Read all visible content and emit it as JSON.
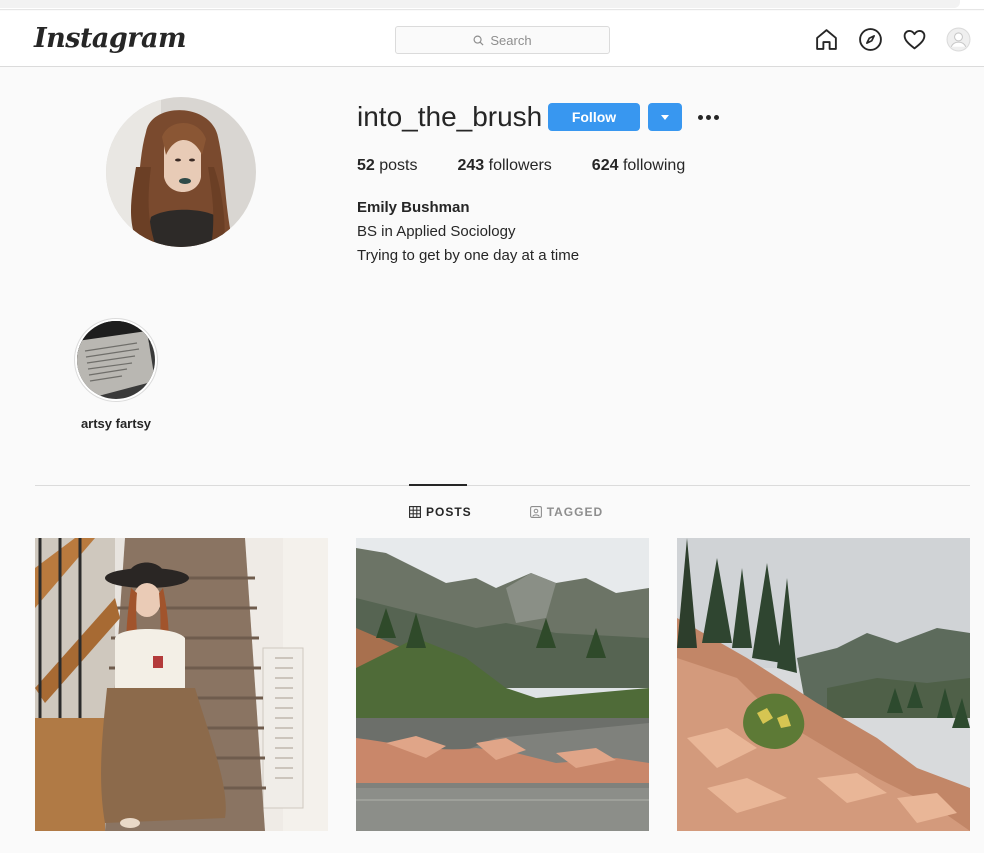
{
  "header": {
    "logo": "Instagram",
    "search_placeholder": "Search",
    "icons": [
      "home-icon",
      "explore-icon",
      "activity-heart-icon",
      "profile-avatar-icon"
    ]
  },
  "profile": {
    "username": "into_the_brush",
    "follow_label": "Follow",
    "stats": {
      "posts_count": "52",
      "posts_label": "posts",
      "followers_count": "243",
      "followers_label": "followers",
      "following_count": "624",
      "following_label": "following"
    },
    "full_name": "Emily Bushman",
    "bio_lines": [
      "BS in Applied Sociology",
      "Trying to get by one day at a time"
    ]
  },
  "highlights": [
    {
      "label": "artsy fartsy"
    }
  ],
  "tabs": [
    {
      "label": "POSTS",
      "active": true,
      "icon": "grid-icon"
    },
    {
      "label": "TAGGED",
      "active": false,
      "icon": "tagged-icon"
    }
  ],
  "colors": {
    "accent": "#3897f0",
    "text": "#262626",
    "muted": "#8e8e8e",
    "border": "#dbdbdb",
    "background": "#fafafa"
  }
}
